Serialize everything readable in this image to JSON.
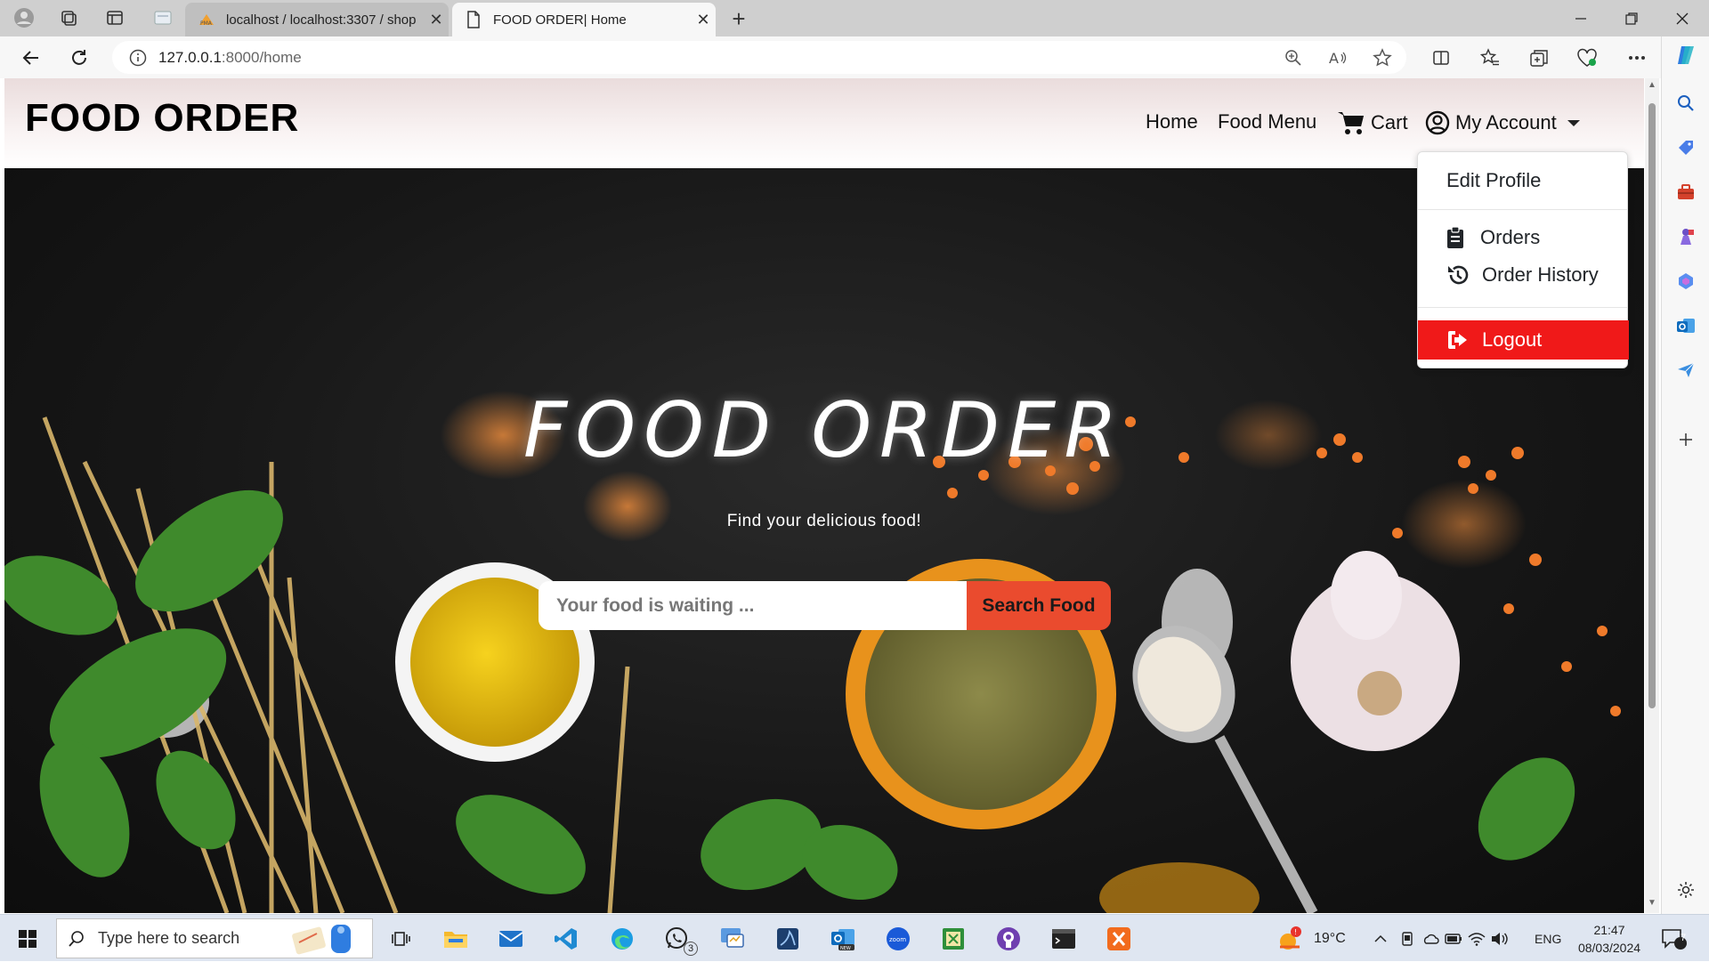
{
  "browser": {
    "tabs": [
      {
        "title": "localhost / localhost:3307 / shop",
        "active": false
      },
      {
        "title": "FOOD ORDER| Home",
        "active": true
      }
    ],
    "url_host": "127.0.0.1",
    "url_rest": ":8000/home"
  },
  "site": {
    "brand": "FOOD ORDER",
    "nav": {
      "home": "Home",
      "food_menu": "Food Menu",
      "cart": "Cart",
      "account": "My Account"
    },
    "dropdown": {
      "edit_profile": "Edit Profile",
      "orders": "Orders",
      "order_history": "Order History",
      "logout": "Logout"
    },
    "hero": {
      "title": "FOOD ORDER",
      "subtitle": "Find your delicious food!",
      "search_placeholder": "Your food is waiting ...",
      "search_button": "Search Food"
    }
  },
  "taskbar": {
    "search_placeholder": "Type here to search",
    "whatsapp_badge": "3",
    "weather": "19°C",
    "language": "ENG",
    "time": "21:47",
    "date": "08/03/2024",
    "notifications": "7"
  },
  "colors": {
    "accent_search": "#ea4b2e",
    "logout_red": "#f01919"
  }
}
